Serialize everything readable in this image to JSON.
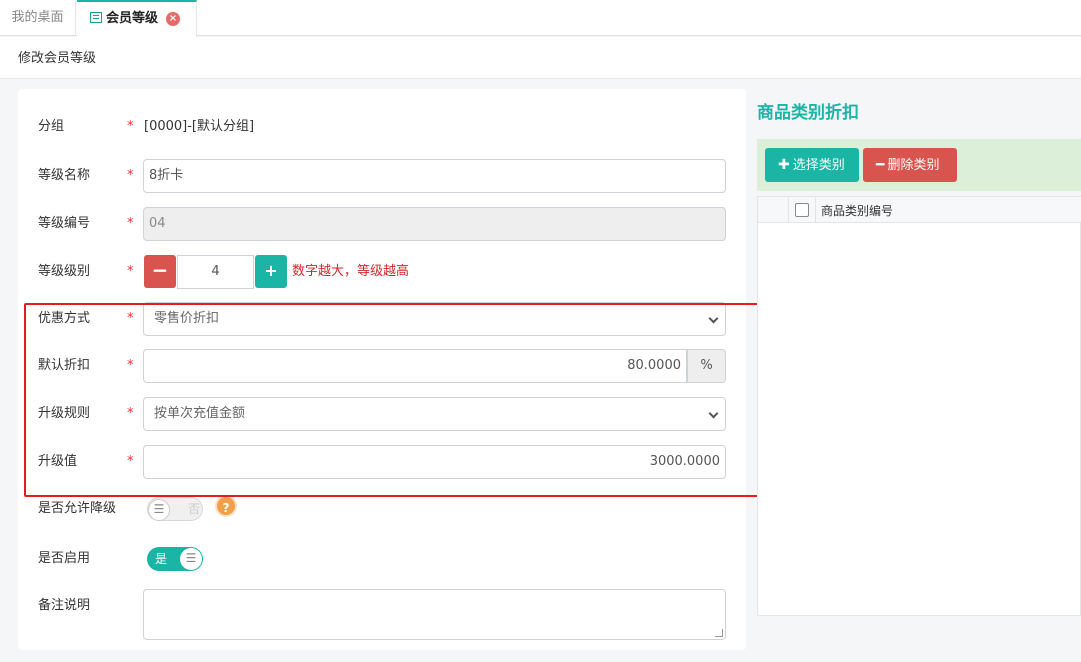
{
  "tabs": [
    {
      "label": "我的桌面"
    },
    {
      "label": "会员等级",
      "close": "×"
    }
  ],
  "breadcrumb": "修改会员等级",
  "form": {
    "group": {
      "label": "分组",
      "required": "*",
      "value": "[0000]-[默认分组]"
    },
    "level_name": {
      "label": "等级名称",
      "required": "*",
      "value": "8折卡"
    },
    "level_code": {
      "label": "等级编号",
      "required": "*",
      "value": "04"
    },
    "level_rank": {
      "label": "等级级别",
      "required": "*",
      "minus": "−",
      "value": "4",
      "plus": "+",
      "hint": "数字越大，等级越高"
    },
    "discount_mode": {
      "label": "优惠方式",
      "required": "*",
      "value": "零售价折扣"
    },
    "default_discount": {
      "label": "默认折扣",
      "required": "*",
      "value": "80.0000",
      "unit": "%"
    },
    "upgrade_rule": {
      "label": "升级规则",
      "required": "*",
      "value": "按单次充值金额"
    },
    "upgrade_value": {
      "label": "升级值",
      "required": "*",
      "value": "3000.0000"
    },
    "allow_downgrade": {
      "label": "是否允许降级",
      "state": "否",
      "knob": "☰",
      "help": "?"
    },
    "enabled": {
      "label": "是否启用",
      "state": "是",
      "knob": "☰"
    },
    "remark": {
      "label": "备注说明",
      "value": ""
    }
  },
  "right_panel": {
    "title": "商品类别折扣",
    "select_button": {
      "symbol": "✚",
      "label": "选择类别"
    },
    "delete_button": {
      "symbol": "━",
      "label": "删除类别"
    },
    "column_header": "商品类别编号"
  },
  "colors": {
    "accent": "#1bb5a6",
    "danger": "#d9534f",
    "highlight": "#e41c1c"
  }
}
